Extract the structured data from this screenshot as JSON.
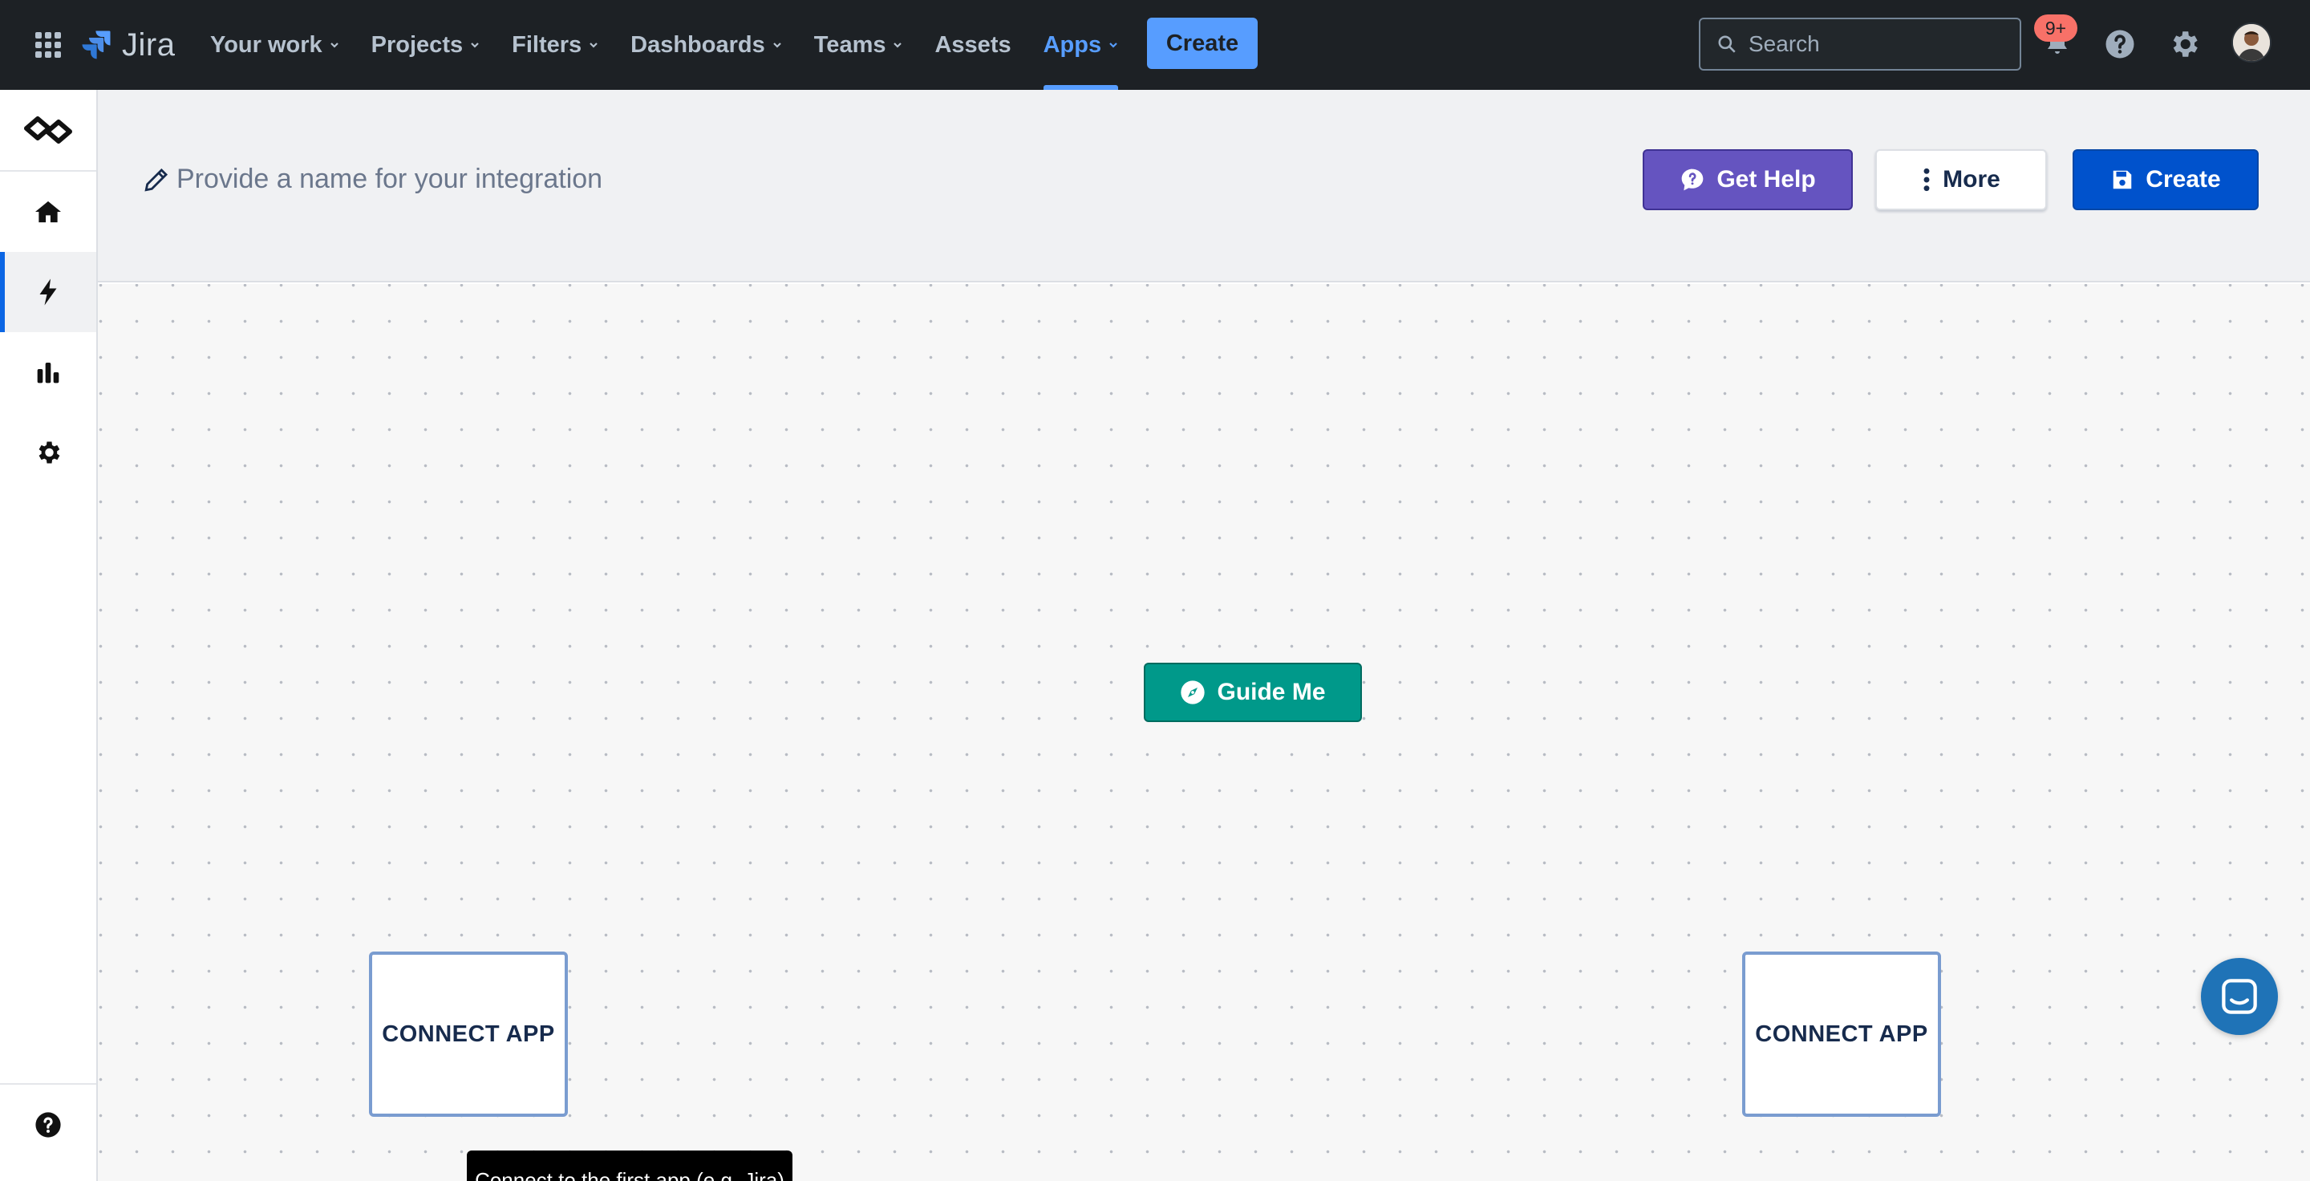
{
  "topnav": {
    "product_name": "Jira",
    "items": [
      {
        "label": "Your work",
        "dropdown": true
      },
      {
        "label": "Projects",
        "dropdown": true
      },
      {
        "label": "Filters",
        "dropdown": true
      },
      {
        "label": "Dashboards",
        "dropdown": true
      },
      {
        "label": "Teams",
        "dropdown": true
      },
      {
        "label": "Assets",
        "dropdown": false
      },
      {
        "label": "Apps",
        "dropdown": true,
        "active": true
      }
    ],
    "create_label": "Create",
    "search_placeholder": "Search",
    "notifications_badge": "9+",
    "accent_color": "#579dff"
  },
  "rail": {
    "items": [
      {
        "name": "app-logo-icon"
      },
      {
        "name": "home-icon"
      },
      {
        "name": "bolt-icon",
        "active": true
      },
      {
        "name": "bar-chart-icon"
      },
      {
        "name": "gear-icon"
      },
      {
        "name": "help-icon"
      }
    ]
  },
  "header": {
    "name_placeholder": "Provide a name for your integration",
    "get_help_label": "Get Help",
    "more_label": "More",
    "create_label": "Create"
  },
  "canvas": {
    "guide_me_label": "Guide Me",
    "connect_app_left": "CONNECT APP",
    "connect_app_right": "CONNECT APP",
    "tooltip": "Connect to the first app (e.g. Jira)"
  },
  "colors": {
    "topnav_bg": "#1d2125",
    "help_button": "#6554c0",
    "create_button": "#0052cc",
    "guide_button": "#00998a",
    "chat_launcher": "#1f73b7"
  }
}
